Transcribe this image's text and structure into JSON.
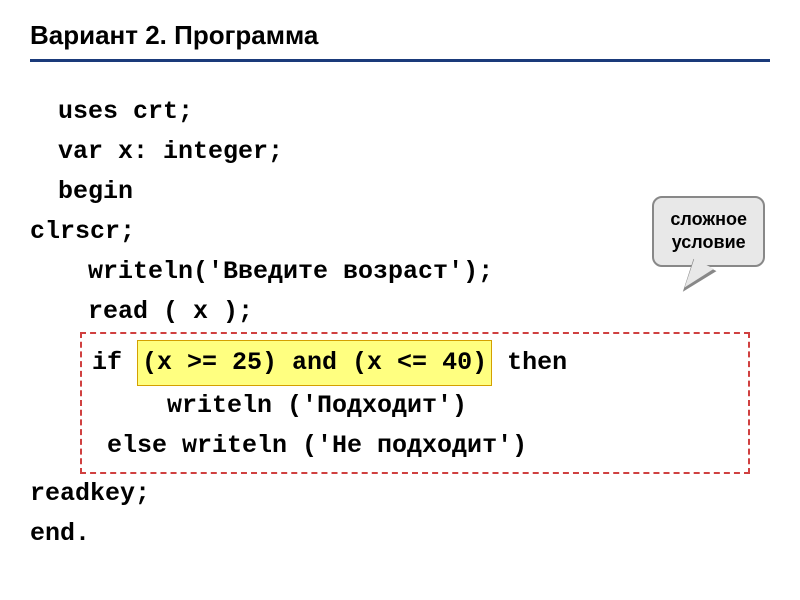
{
  "title": "Вариант 2. Программа",
  "code": {
    "line1": "uses crt;",
    "line2": "var x: integer;",
    "line3": "begin",
    "line4": "clrscr;",
    "line5": "  writeln('Введите возраст');",
    "line6": "  read ( x );",
    "line7_if": "if ",
    "line7_cond": "(x >= 25) and (x <= 40)",
    "line7_then": " then",
    "line8": "     writeln ('Подходит')",
    "line9": " else writeln ('Не подходит')",
    "line10": "readkey;",
    "line11": "end."
  },
  "callout": {
    "line1": "сложное",
    "line2": "условие"
  }
}
